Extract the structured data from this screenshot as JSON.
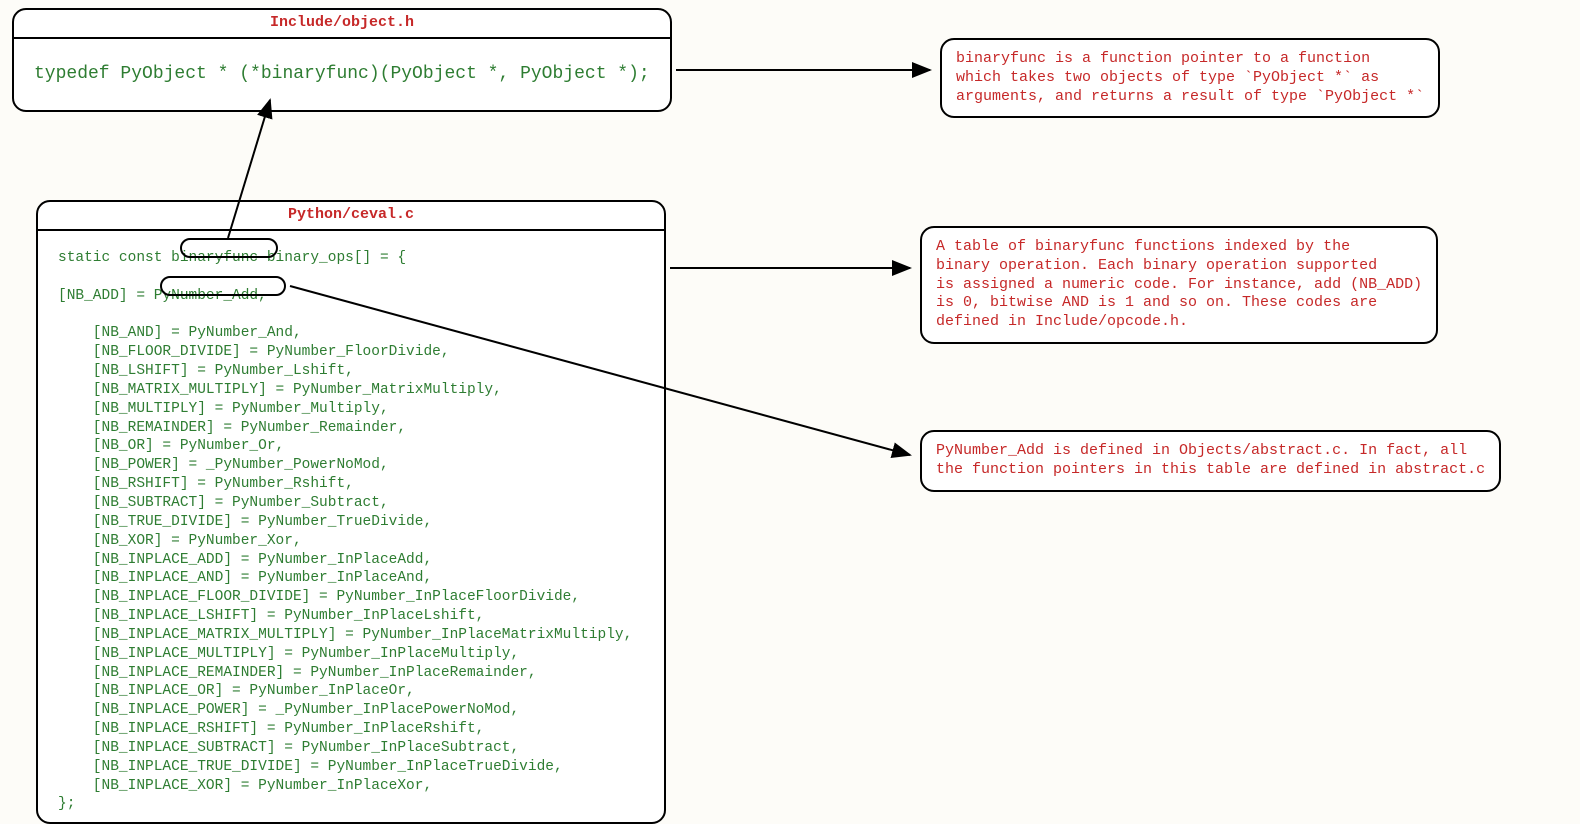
{
  "box1": {
    "title": "Include/object.h",
    "code": "typedef PyObject * (*binaryfunc)(PyObject *, PyObject *);"
  },
  "box2": {
    "title": "Python/ceval.c",
    "code_head": "static const binaryfunc binary_ops[] = {",
    "code_nbadd": "[NB_ADD] = PyNumber_Add,",
    "code_rest": "    [NB_AND] = PyNumber_And,\n    [NB_FLOOR_DIVIDE] = PyNumber_FloorDivide,\n    [NB_LSHIFT] = PyNumber_Lshift,\n    [NB_MATRIX_MULTIPLY] = PyNumber_MatrixMultiply,\n    [NB_MULTIPLY] = PyNumber_Multiply,\n    [NB_REMAINDER] = PyNumber_Remainder,\n    [NB_OR] = PyNumber_Or,\n    [NB_POWER] = _PyNumber_PowerNoMod,\n    [NB_RSHIFT] = PyNumber_Rshift,\n    [NB_SUBTRACT] = PyNumber_Subtract,\n    [NB_TRUE_DIVIDE] = PyNumber_TrueDivide,\n    [NB_XOR] = PyNumber_Xor,\n    [NB_INPLACE_ADD] = PyNumber_InPlaceAdd,\n    [NB_INPLACE_AND] = PyNumber_InPlaceAnd,\n    [NB_INPLACE_FLOOR_DIVIDE] = PyNumber_InPlaceFloorDivide,\n    [NB_INPLACE_LSHIFT] = PyNumber_InPlaceLshift,\n    [NB_INPLACE_MATRIX_MULTIPLY] = PyNumber_InPlaceMatrixMultiply,\n    [NB_INPLACE_MULTIPLY] = PyNumber_InPlaceMultiply,\n    [NB_INPLACE_REMAINDER] = PyNumber_InPlaceRemainder,\n    [NB_INPLACE_OR] = PyNumber_InPlaceOr,\n    [NB_INPLACE_POWER] = _PyNumber_InPlacePowerNoMod,\n    [NB_INPLACE_RSHIFT] = PyNumber_InPlaceRshift,\n    [NB_INPLACE_SUBTRACT] = PyNumber_InPlaceSubtract,\n    [NB_INPLACE_TRUE_DIVIDE] = PyNumber_InPlaceTrueDivide,\n    [NB_INPLACE_XOR] = PyNumber_InPlaceXor,\n};"
  },
  "callouts": {
    "c1": "binaryfunc is a function pointer to a function\nwhich takes two objects of type `PyObject *` as\narguments, and returns a result of type `PyObject *`",
    "c2": "A table of binaryfunc functions indexed by the\nbinary operation. Each binary operation supported\nis assigned a numeric code. For instance, add (NB_ADD)\nis 0, bitwise AND is 1 and so on. These codes are\ndefined in Include/opcode.h.",
    "c3": "PyNumber_Add is defined in Objects/abstract.c. In fact, all\nthe function pointers in this table are defined in abstract.c"
  }
}
